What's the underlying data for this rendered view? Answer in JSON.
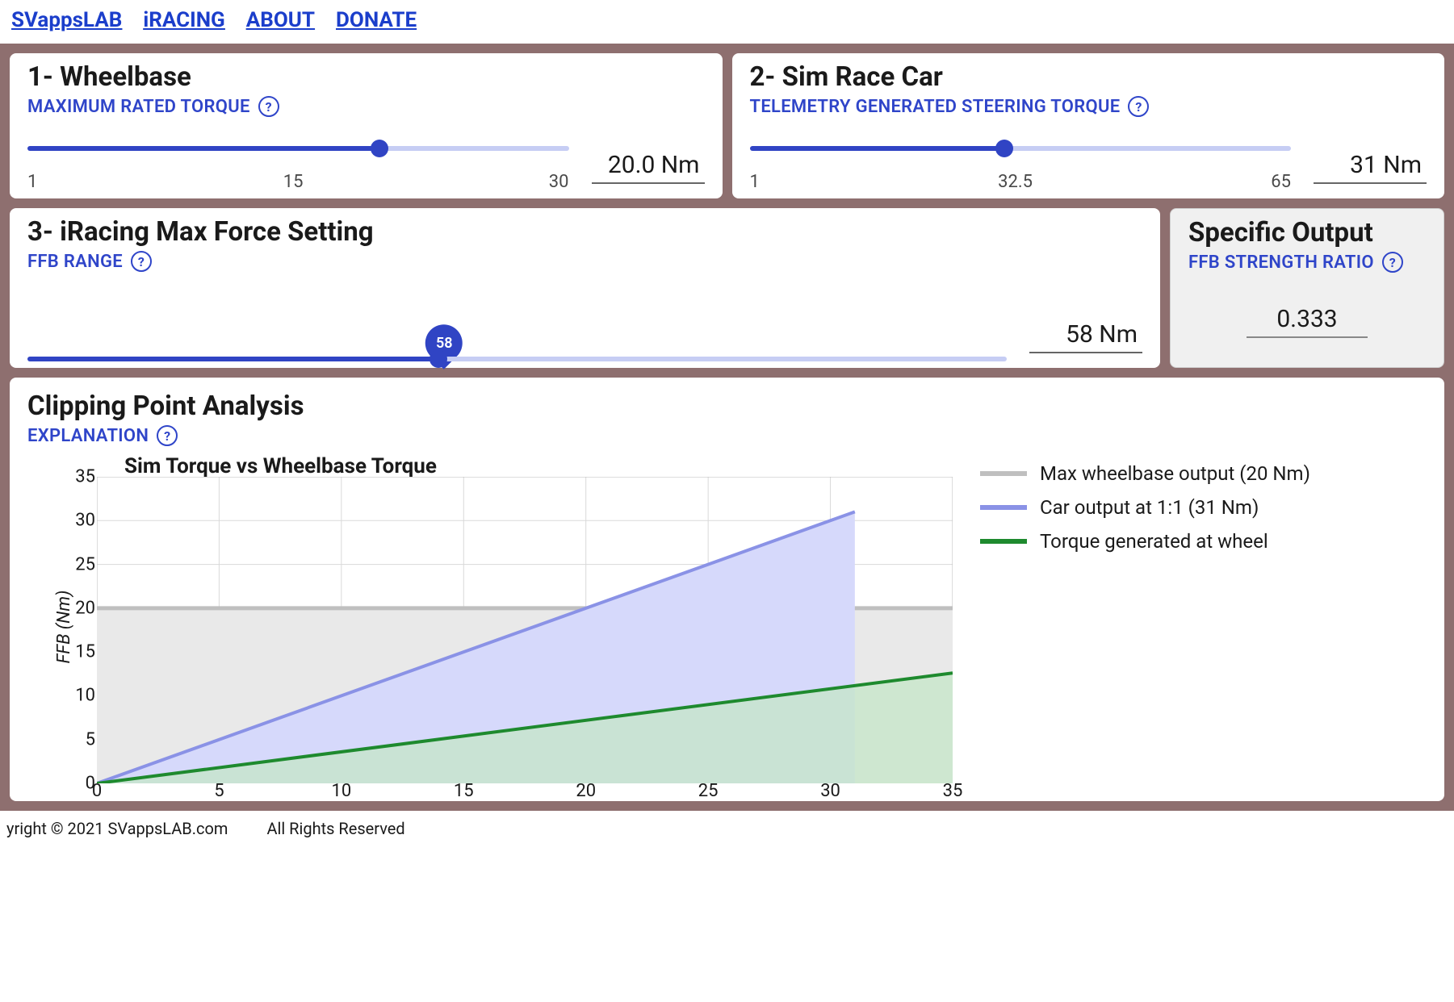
{
  "nav": {
    "items": [
      "SVappsLAB",
      "iRACING",
      "ABOUT",
      "DONATE"
    ]
  },
  "cards": {
    "wheelbase": {
      "title": "1- Wheelbase",
      "subtitle": "MAXIMUM RATED TORQUE",
      "tick_min": "1",
      "tick_mid": "15",
      "tick_max": "30",
      "value": "20.0 Nm",
      "fill_pct": 65
    },
    "car": {
      "title": "2- Sim Race Car",
      "subtitle": "TELEMETRY GENERATED STEERING TORQUE",
      "tick_min": "1",
      "tick_mid": "32.5",
      "tick_max": "65",
      "value": "31 Nm",
      "fill_pct": 47
    },
    "maxforce": {
      "title": "3- iRacing Max Force Setting",
      "subtitle": "FFB RANGE",
      "bubble": "58",
      "value": "58 Nm",
      "fill_pct": 42
    },
    "output": {
      "title": "Specific Output",
      "subtitle": "FFB STRENGTH RATIO",
      "value": "0.333"
    },
    "clip": {
      "title": "Clipping Point Analysis",
      "subtitle": "EXPLANATION"
    }
  },
  "chart_data": {
    "type": "line",
    "title": "Sim Torque vs Wheelbase Torque",
    "xlabel": "",
    "ylabel": "FFB (Nm)",
    "xlim": [
      0,
      35
    ],
    "ylim": [
      0,
      35
    ],
    "xticks": [
      0,
      5,
      10,
      15,
      20,
      25,
      30,
      35
    ],
    "yticks": [
      0,
      5,
      10,
      15,
      20,
      25,
      30,
      35
    ],
    "series": [
      {
        "name": "Max wheelbase output (20 Nm)",
        "color": "#bfbfbf",
        "fill": "#e9e9e9",
        "x": [
          0,
          35
        ],
        "y": [
          20,
          20
        ]
      },
      {
        "name": "Car output at 1:1 (31 Nm)",
        "color": "#8a92e6",
        "fill": "#d6d9fb",
        "x": [
          0,
          31
        ],
        "y": [
          0,
          31
        ]
      },
      {
        "name": "Torque generated at wheel",
        "color": "#1e8a2e",
        "fill": "#c4e5c7",
        "x": [
          0,
          35
        ],
        "y": [
          0,
          12.6
        ]
      }
    ]
  },
  "legend": [
    {
      "label": "Max wheelbase output (20 Nm)",
      "color": "#bfbfbf"
    },
    {
      "label": "Car output at 1:1 (31 Nm)",
      "color": "#8a92e6"
    },
    {
      "label": "Torque generated at wheel",
      "color": "#1e8a2e"
    }
  ],
  "footer": {
    "copyright": "yright © 2021 SVappsLAB.com",
    "rights": "All Rights Reserved"
  }
}
